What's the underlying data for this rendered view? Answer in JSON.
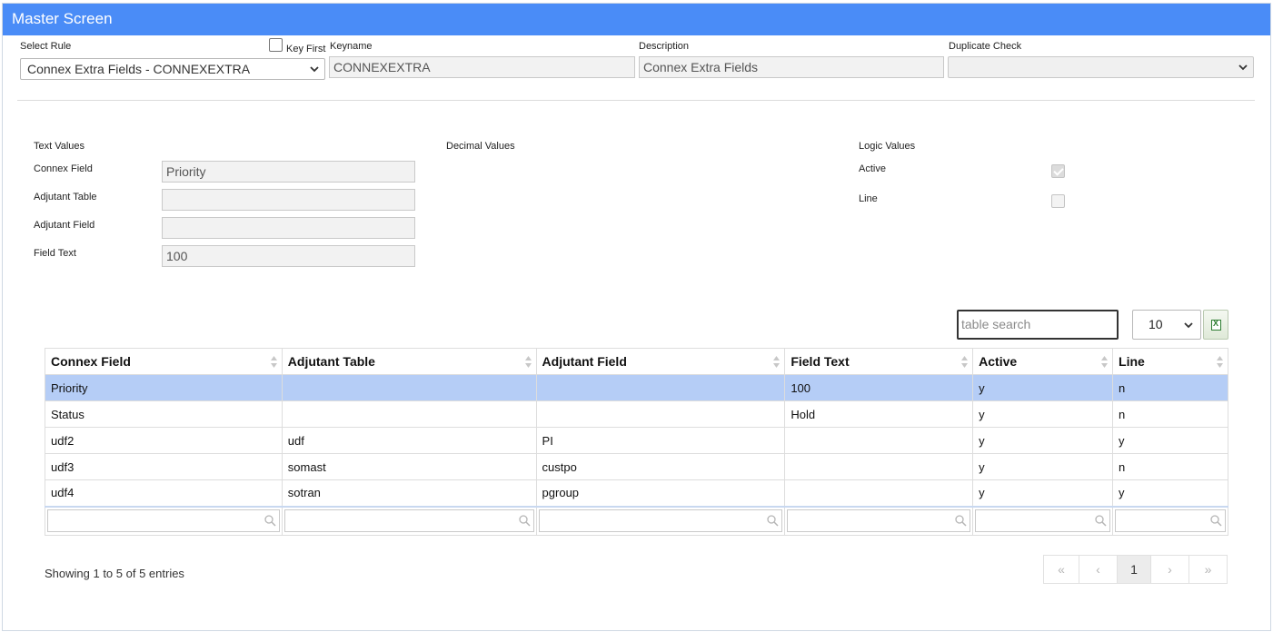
{
  "window": {
    "title": "Master Screen"
  },
  "header": {
    "select_rule_label": "Select Rule",
    "select_rule_value": "Connex Extra Fields - CONNEXEXTRA",
    "key_first_label": "Key First",
    "keyname_label": "Keyname",
    "keyname_value": "CONNEXEXTRA",
    "description_label": "Description",
    "description_value": "Connex Extra Fields",
    "duplicate_check_label": "Duplicate Check",
    "duplicate_check_value": ""
  },
  "text_values": {
    "section_label": "Text Values",
    "fields": [
      {
        "label": "Connex Field",
        "value": "Priority"
      },
      {
        "label": "Adjutant Table",
        "value": ""
      },
      {
        "label": "Adjutant Field",
        "value": ""
      },
      {
        "label": "Field Text",
        "value": "100"
      }
    ]
  },
  "decimal_values": {
    "section_label": "Decimal Values"
  },
  "logic_values": {
    "section_label": "Logic Values",
    "fields": [
      {
        "label": "Active",
        "checked": true
      },
      {
        "label": "Line",
        "checked": false
      }
    ]
  },
  "table_controls": {
    "search_placeholder": "table search",
    "page_size": "10",
    "export_icon": "excel-export-icon"
  },
  "table": {
    "columns": [
      "Connex Field",
      "Adjutant Table",
      "Adjutant Field",
      "Field Text",
      "Active",
      "Line"
    ],
    "rows": [
      [
        "Priority",
        "",
        "",
        "100",
        "y",
        "n"
      ],
      [
        "Status",
        "",
        "",
        "Hold",
        "y",
        "n"
      ],
      [
        "udf2",
        "udf",
        "PI",
        "",
        "y",
        "y"
      ],
      [
        "udf3",
        "somast",
        "custpo",
        "",
        "y",
        "n"
      ],
      [
        "udf4",
        "sotran",
        "pgroup",
        "",
        "y",
        "y"
      ]
    ],
    "selected_row": 0
  },
  "footer": {
    "info": "Showing 1 to 5 of 5 entries",
    "pager": {
      "first": "«",
      "prev": "‹",
      "current": "1",
      "next": "›",
      "last": "»"
    }
  },
  "colors": {
    "titlebar": "#4a8cf7",
    "selected_row": "#b5cdf6"
  }
}
